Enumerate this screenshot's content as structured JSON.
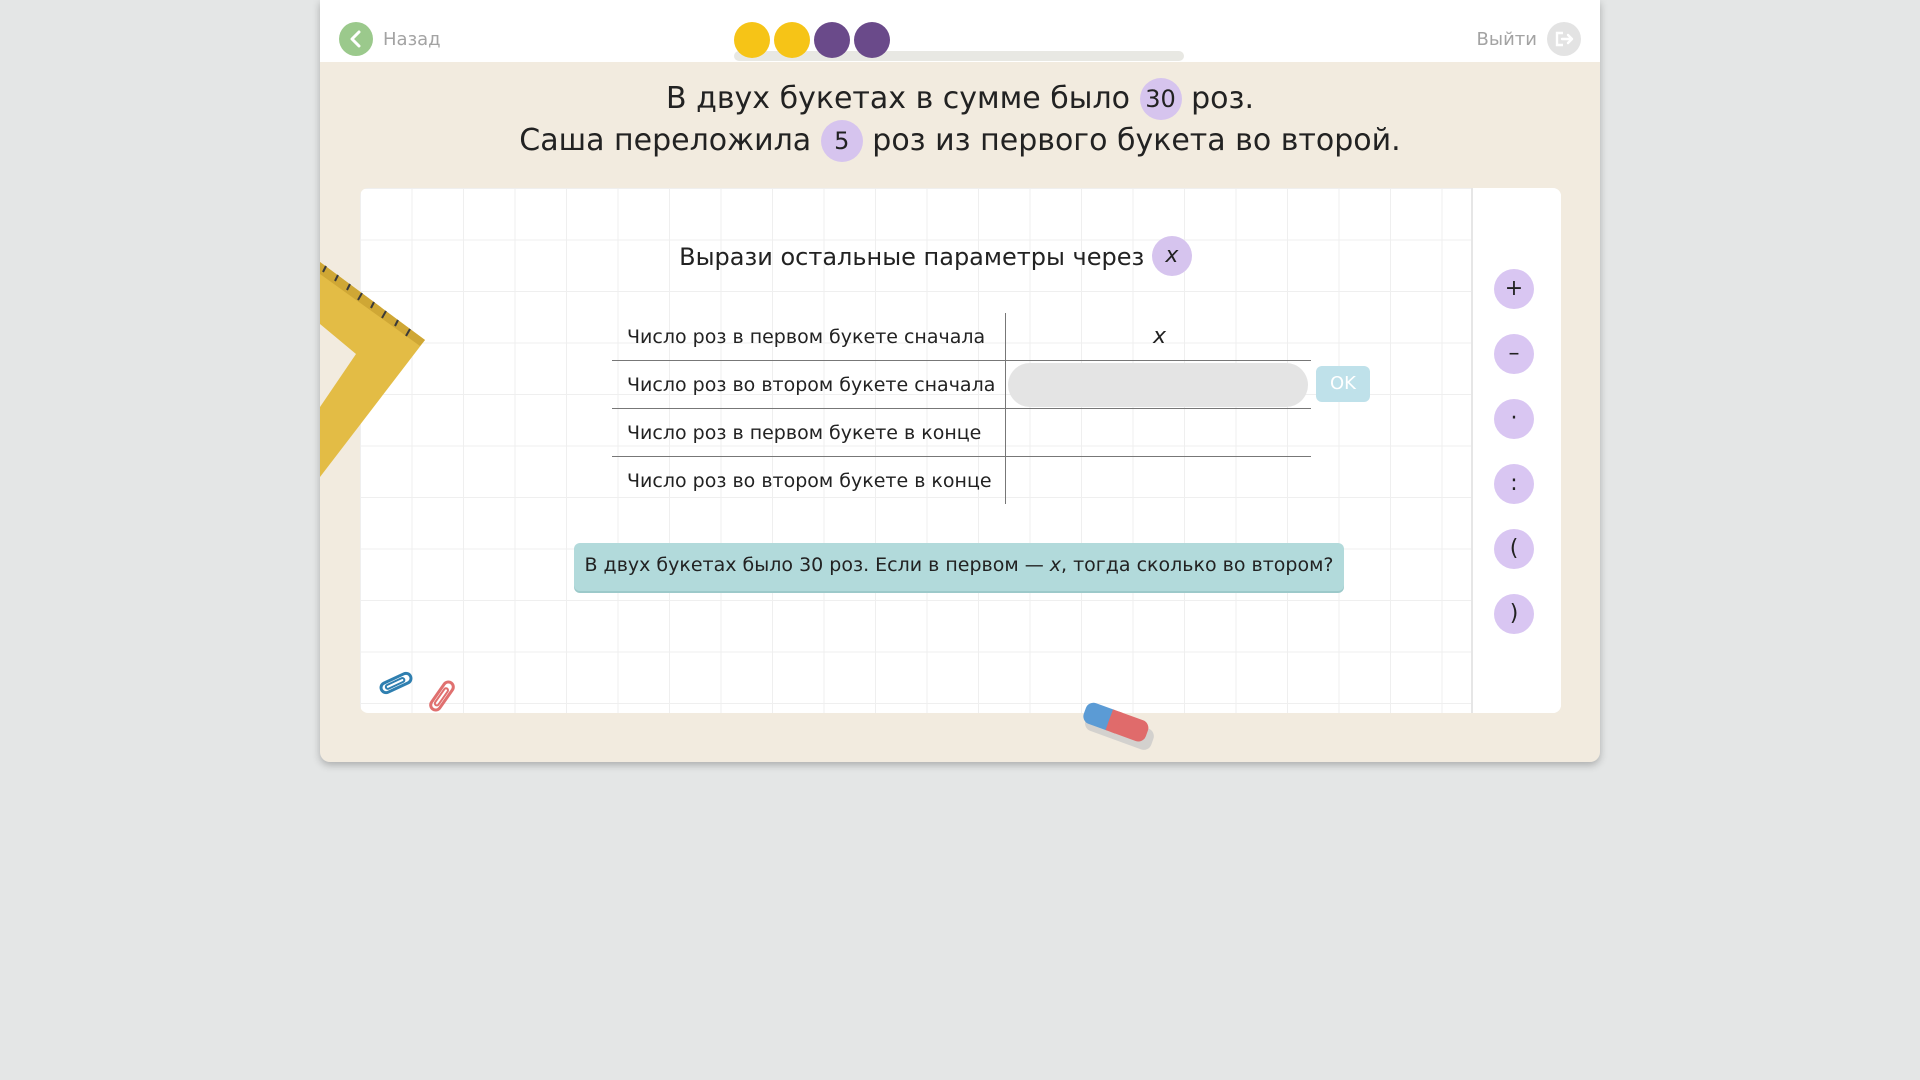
{
  "header": {
    "back_label": "Назад",
    "exit_label": "Выйти",
    "progress_dots": [
      {
        "state": "done",
        "color": "#f6c417"
      },
      {
        "state": "done",
        "color": "#f6c417"
      },
      {
        "state": "pending",
        "color": "#6a4a8a"
      },
      {
        "state": "pending",
        "color": "#6a4a8a"
      }
    ]
  },
  "problem": {
    "line1_a": "В двух букетах в сумме было",
    "line1_num": "30",
    "line1_b": "роз.",
    "line2_a": "Саша переложила",
    "line2_num": "5",
    "line2_b": "роз из первого букета во второй."
  },
  "task": {
    "text": "Вырази остальные параметры через",
    "variable": "x"
  },
  "table": {
    "rows": [
      {
        "label": "Число роз в первом букете сначала",
        "value": "x"
      },
      {
        "label": "Число роз во втором букете сначала",
        "value": ""
      },
      {
        "label": "Число роз в первом букете в конце",
        "value": ""
      },
      {
        "label": "Число роз во втором букете в конце",
        "value": ""
      }
    ],
    "input_value": "",
    "ok_label": "OK"
  },
  "hint": {
    "part1": "В двух букетах было 30 роз. Если в первом — ",
    "var": "x",
    "part2": ", тогда сколько во втором?"
  },
  "operators": [
    "+",
    "–",
    "·",
    ":",
    "(",
    ")"
  ],
  "colors": {
    "accent_chip": "#d6c4ee",
    "hint_bg": "#b2dadb",
    "back_icon": "#9bc98c"
  }
}
